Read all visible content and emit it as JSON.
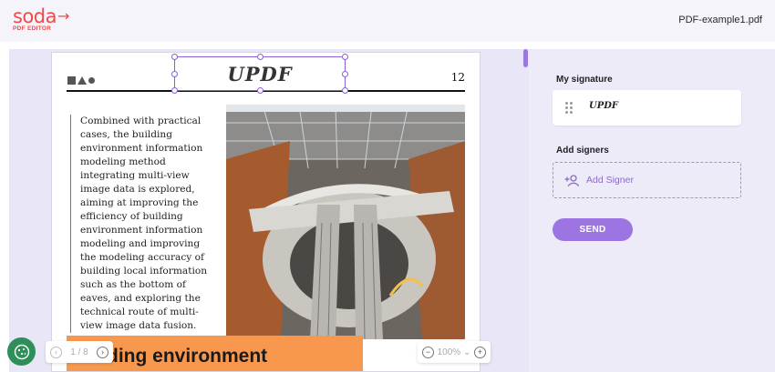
{
  "app": {
    "logo_text": "soda",
    "logo_subtitle": "PDF EDITOR",
    "file_name": "PDF-example1.pdf"
  },
  "document": {
    "page_number": "12",
    "signature_text": "UPDF",
    "body_text": "Combined with practical cases, the building environment information modeling method integrating multi-view image data is explored, aiming at improving the efficiency of building environment information modeling and improving the modeling accuracy of building local information such as the bottom of eaves, and exploring the technical route of multi-view image data fusion.",
    "heading_partial": "ding environment"
  },
  "page_nav": {
    "current": "1",
    "separator": "/",
    "total": "8",
    "label": "1 / 8"
  },
  "zoom": {
    "level": "100%"
  },
  "panel": {
    "my_signature_title": "My signature",
    "signature_preview": "UPDF",
    "add_signers_title": "Add signers",
    "add_signer_label": "Add Signer",
    "send_label": "SEND"
  },
  "icons": {
    "prev": "chevron-left-icon",
    "next": "chevron-right-icon",
    "zoom_out": "minus-circle-icon",
    "zoom_in": "plus-circle-icon",
    "add_person": "add-person-icon",
    "drag": "drag-handle-icon",
    "cookie": "cookie-icon"
  },
  "colors": {
    "brand_red": "#ef4a4a",
    "accent_purple": "#9d75e3",
    "panel_bg": "#edebf7",
    "orange": "#f7984e"
  }
}
